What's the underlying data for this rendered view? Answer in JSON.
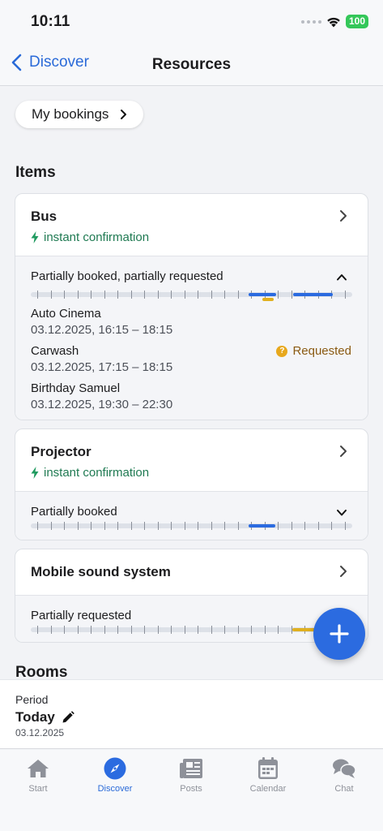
{
  "status": {
    "time": "10:11",
    "battery": "100"
  },
  "nav": {
    "back_label": "Discover",
    "title": "Resources"
  },
  "bookings_pill": "My bookings",
  "sections": {
    "items": "Items",
    "rooms": "Rooms"
  },
  "items": [
    {
      "name": "Bus",
      "instant": "instant confirmation",
      "status": "Partially booked, partially requested",
      "expanded": true,
      "bookings": [
        {
          "title": "Auto Cinema",
          "time": "03.12.2025, 16:15 – 18:15"
        },
        {
          "title": "Carwash",
          "time": "03.12.2025, 17:15 – 18:15",
          "badge": "Requested"
        },
        {
          "title": "Birthday Samuel",
          "time": "03.12.2025, 19:30 – 22:30"
        }
      ]
    },
    {
      "name": "Projector",
      "instant": "instant confirmation",
      "status": "Partially booked",
      "expanded": false
    },
    {
      "name": "Mobile sound system",
      "status": "Partially requested",
      "expanded": false
    }
  ],
  "period": {
    "label": "Period",
    "value": "Today",
    "date": "03.12.2025"
  },
  "tabs": [
    {
      "label": "Start",
      "icon": "home-icon"
    },
    {
      "label": "Discover",
      "icon": "compass-icon",
      "active": true
    },
    {
      "label": "Posts",
      "icon": "newspaper-icon"
    },
    {
      "label": "Calendar",
      "icon": "calendar-icon"
    },
    {
      "label": "Chat",
      "icon": "chat-bubbles-icon"
    }
  ],
  "colors": {
    "accent": "#2b6be0",
    "instant": "#1f7a52",
    "requested": "#e0b020",
    "booked": "#2b6be0"
  }
}
